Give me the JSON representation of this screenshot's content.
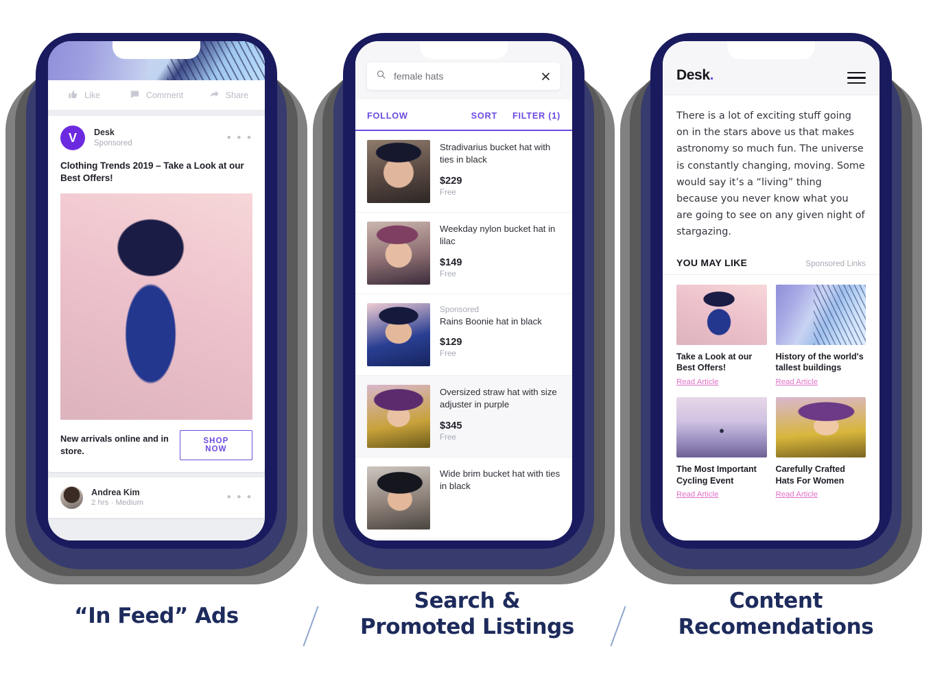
{
  "theme": {
    "accent_purple": "#6c4ae0",
    "brand_violet": "#6c2ae0",
    "phone_navy": "#1a1b5e",
    "stack_indigo": "#383b6e",
    "stack_dark_gray": "#5a5a5a",
    "stack_gray": "#818181",
    "caption_navy": "#1d2b5c",
    "link_pink": "#e070c8"
  },
  "phone1": {
    "name": "In Feed Ads phone",
    "feed_actions": [
      {
        "icon": "thumbs-up-icon",
        "label": "Like"
      },
      {
        "icon": "comment-icon",
        "label": "Comment"
      },
      {
        "icon": "share-icon",
        "label": "Share"
      }
    ],
    "ad": {
      "avatar_letter": "V",
      "brand": "Desk",
      "sponsored_label": "Sponsored",
      "more_dots": "• • •",
      "title": "Clothing Trends 2019 – Take a Look at our Best Offers!",
      "footer_text": "New arrivals online and in store.",
      "cta_label": "SHOP NOW"
    },
    "post": {
      "author": "Andrea Kim",
      "meta": "2 hrs · Medium",
      "more_dots": "• • •"
    }
  },
  "phone2": {
    "name": "Search and Promoted Listings phone",
    "search": {
      "icon": "search-icon",
      "value": "female hats",
      "placeholder": "Search",
      "clear_icon": "close-icon"
    },
    "tabs": {
      "follow": "FOLLOW",
      "sort": "SORT",
      "filter": "FILTER (1)"
    },
    "listings": [
      {
        "thumb": "ph-girl-hat",
        "sponsored": "",
        "name": "Stradivarius bucket hat with ties in black",
        "price": "$229",
        "shipping": "Free",
        "shaded": false
      },
      {
        "thumb": "ph-girl-lilac",
        "sponsored": "",
        "name": "Weekday nylon bucket hat in lilac",
        "price": "$149",
        "shipping": "Free",
        "shaded": false
      },
      {
        "thumb": "ph-girl-blue",
        "sponsored": "Sponsored",
        "name": "Rains Boonie hat in black",
        "price": "$129",
        "shipping": "Free",
        "shaded": false
      },
      {
        "thumb": "ph-girl-purp",
        "sponsored": "",
        "name": "Oversized straw hat with size adjuster in purple",
        "price": "$345",
        "shipping": "Free",
        "shaded": true
      },
      {
        "thumb": "ph-girl-wide",
        "sponsored": "",
        "name": "Wide brim bucket hat with ties in black",
        "price": "",
        "shipping": "",
        "shaded": false
      }
    ]
  },
  "phone3": {
    "name": "Content Recomendations phone",
    "header": {
      "logo": "Desk",
      "logo_dot": ".",
      "menu_icon": "hamburger-menu-icon"
    },
    "article_text": "There is a lot of exciting stuff going on in the stars above us that makes astronomy so much fun. The universe is constantly changing, moving. Some would say it’s a “living” thing because you never know what you are going to see on any given night of stargazing.",
    "recommendations": {
      "title": "YOU MAY LIKE",
      "sponsored_label": "Sponsored Links",
      "items": [
        {
          "thumb": "ph-blossom",
          "title": "Take a Look at our Best Offers!",
          "link": "Read Article"
        },
        {
          "thumb": "ph-building",
          "title": "History of the world's tallest buildings",
          "link": "Read Article"
        },
        {
          "thumb": "ph-cycling",
          "title": "The Most Important Cycling Event",
          "link": "Read Article"
        },
        {
          "thumb": "ph-yellow",
          "title": "Carefully Crafted Hats For Women",
          "link": "Read Article"
        }
      ]
    }
  },
  "captions": [
    {
      "line1": "“In Feed” Ads",
      "line2": ""
    },
    {
      "line1": "Search &",
      "line2": "Promoted Listings"
    },
    {
      "line1": "Content",
      "line2": "Recomendations"
    }
  ]
}
